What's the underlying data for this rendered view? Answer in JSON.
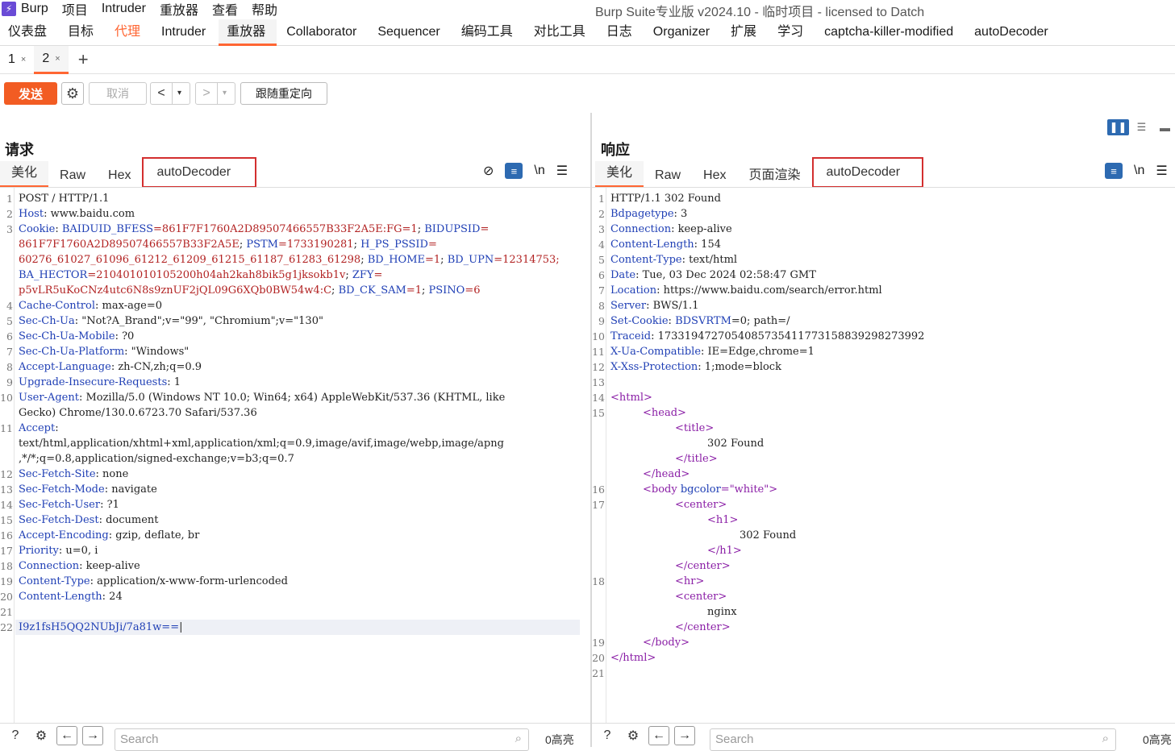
{
  "menubar": {
    "logo": "⚡",
    "items": [
      "Burp",
      "项目",
      "Intruder",
      "重放器",
      "查看",
      "帮助"
    ],
    "window_title": "Burp Suite专业版  v2024.10 - 临时项目 - licensed to Datch"
  },
  "top_tabs": [
    "仪表盘",
    "目标",
    "代理",
    "Intruder",
    "重放器",
    "Collaborator",
    "Sequencer",
    "编码工具",
    "对比工具",
    "日志",
    "Organizer",
    "扩展",
    "学习",
    "captcha-killer-modified",
    "autoDecoder"
  ],
  "active_top_tab": "重放器",
  "sub_tabs": [
    {
      "label": "1",
      "close": "×"
    },
    {
      "label": "2",
      "close": "×"
    }
  ],
  "add_tab": "+",
  "toolbar": {
    "send": "发送",
    "cancel": "取消",
    "back": "<",
    "forward": ">",
    "dropdown": "▾",
    "follow_redirect": "跟随重定向"
  },
  "request": {
    "title": "请求",
    "tabs": [
      "美化",
      "Raw",
      "Hex",
      "autoDecoder"
    ],
    "active_tab": "美化",
    "newline_toggle": "\\n",
    "search_placeholder": "Search",
    "hits": "0高亮"
  },
  "response": {
    "title": "响应",
    "tabs": [
      "美化",
      "Raw",
      "Hex",
      "页面渲染",
      "autoDecoder"
    ],
    "active_tab": "美化",
    "newline_toggle": "\\n",
    "search_placeholder": "Search",
    "hits": "0高亮"
  },
  "request_lines": [
    {
      "n": "1",
      "t": "POST / HTTP/1.1"
    },
    {
      "n": "2",
      "k": "Host",
      "v": " www.baidu.com"
    },
    {
      "n": "3",
      "cookie1": true
    },
    {
      "n": "",
      "cv": "861F7F1760A2D89507466557B33F2A5E",
      "rest": "; ",
      "k2": "PSTM",
      "v2": "=1733190281",
      "rest2": "; ",
      "k3": "H_PS_PSSID",
      "rest3": "="
    },
    {
      "n": "",
      "cv": "60276_61027_61096_61212_61209_61215_61187_61283_61298",
      "rest": "; ",
      "k2": "BD_HOME",
      "v2": "=1",
      "rest2": "; ",
      "k3": "BD_UPN",
      "rest3": "=12314753;"
    },
    {
      "n": "",
      "k0": "BA_HECTOR",
      "cv": "=210401010105200h04ah2kah8bik5g1jksokb1v",
      "rest": "; ",
      "k2": "ZFY",
      "v2": "=",
      "rest2": "",
      "k3": "",
      "rest3": ""
    },
    {
      "n": "",
      "cv": "p5vLR5uKoCNz4utc6N8s9znUF2jQL09G6XQb0BW54w4:C",
      "rest": "; ",
      "k2": "BD_CK_SAM",
      "v2": "=1",
      "rest2": "; ",
      "k3": "PSINO",
      "rest3": "=6"
    },
    {
      "n": "4",
      "k": "Cache-Control",
      "v": " max-age=0"
    },
    {
      "n": "5",
      "k": "Sec-Ch-Ua",
      "v": " \"Not?A_Brand\";v=\"99\", \"Chromium\";v=\"130\""
    },
    {
      "n": "6",
      "k": "Sec-Ch-Ua-Mobile",
      "v": " ?0"
    },
    {
      "n": "7",
      "k": "Sec-Ch-Ua-Platform",
      "v": " \"Windows\""
    },
    {
      "n": "8",
      "k": "Accept-Language",
      "v": " zh-CN,zh;q=0.9"
    },
    {
      "n": "9",
      "k": "Upgrade-Insecure-Requests",
      "v": " 1"
    },
    {
      "n": "10",
      "k": "User-Agent",
      "v": " Mozilla/5.0 (Windows NT 10.0; Win64; x64) AppleWebKit/537.36 (KHTML, like"
    },
    {
      "n": "",
      "t": "Gecko) Chrome/130.0.6723.70 Safari/537.36"
    },
    {
      "n": "11",
      "k": "Accept",
      "v": ""
    },
    {
      "n": "",
      "t": "text/html,application/xhtml+xml,application/xml;q=0.9,image/avif,image/webp,image/apng"
    },
    {
      "n": "",
      "t": ",*/*;q=0.8,application/signed-exchange;v=b3;q=0.7"
    },
    {
      "n": "12",
      "k": "Sec-Fetch-Site",
      "v": " none"
    },
    {
      "n": "13",
      "k": "Sec-Fetch-Mode",
      "v": " navigate"
    },
    {
      "n": "14",
      "k": "Sec-Fetch-User",
      "v": " ?1"
    },
    {
      "n": "15",
      "k": "Sec-Fetch-Dest",
      "v": " document"
    },
    {
      "n": "16",
      "k": "Accept-Encoding",
      "v": " gzip, deflate, br"
    },
    {
      "n": "17",
      "k": "Priority",
      "v": " u=0, i"
    },
    {
      "n": "18",
      "k": "Connection",
      "v": " keep-alive"
    },
    {
      "n": "19",
      "k": "Content-Type",
      "v": " application/x-www-form-urlencoded"
    },
    {
      "n": "20",
      "k": "Content-Length",
      "v": " 24"
    },
    {
      "n": "21",
      "t": ""
    },
    {
      "n": "22",
      "body": "I9z1fsH5QQ2NUbJi/7a81w=="
    }
  ],
  "cookie_line": {
    "k": "Cookie",
    "k1": "BAIDUID_BFESS",
    "v1": "=861F7F1760A2D89507466557B33F2A5E:FG=1",
    "k2": "BIDUPSID",
    "v2": "="
  },
  "response_lines": [
    {
      "n": "1",
      "t": "HTTP/1.1 302 Found"
    },
    {
      "n": "2",
      "k": "Bdpagetype",
      "v": " 3"
    },
    {
      "n": "3",
      "k": "Connection",
      "v": " keep-alive"
    },
    {
      "n": "4",
      "k": "Content-Length",
      "v": " 154"
    },
    {
      "n": "5",
      "k": "Content-Type",
      "v": " text/html"
    },
    {
      "n": "6",
      "k": "Date",
      "v": " Tue, 03 Dec 2024 02:58:47 GMT"
    },
    {
      "n": "7",
      "k": "Location",
      "v": " https://www.baidu.com/search/error.html"
    },
    {
      "n": "8",
      "k": "Server",
      "v": " BWS/1.1"
    },
    {
      "n": "9",
      "k": "Set-Cookie",
      "ck": "BDSVRTM",
      "v": "=0; path=/"
    },
    {
      "n": "10",
      "k": "Traceid",
      "v": " 1733194727054085735411773158839298273992"
    },
    {
      "n": "11",
      "k": "X-Ua-Compatible",
      "v": " IE=Edge,chrome=1"
    },
    {
      "n": "12",
      "k": "X-Xss-Protection",
      "v": " 1;mode=block"
    },
    {
      "n": "13",
      "t": ""
    },
    {
      "n": "14",
      "tag": "<html>",
      "ind": 0
    },
    {
      "n": "15",
      "tag": "<head>",
      "ind": 1
    },
    {
      "n": "",
      "tag": "<title>",
      "ind": 2
    },
    {
      "n": "",
      "t": "302 Found",
      "ind": 3
    },
    {
      "n": "",
      "tag": "</title>",
      "ind": 2
    },
    {
      "n": "",
      "tag": "</head>",
      "ind": 1
    },
    {
      "n": "16",
      "tag": "<body ",
      "attr": "bgcolor",
      "str": "=\"white\"",
      "close": ">",
      "ind": 1
    },
    {
      "n": "17",
      "tag": "<center>",
      "ind": 2
    },
    {
      "n": "",
      "tag": "<h1>",
      "ind": 3
    },
    {
      "n": "",
      "t": "302 Found",
      "ind": 4
    },
    {
      "n": "",
      "tag": "</h1>",
      "ind": 3
    },
    {
      "n": "",
      "tag": "</center>",
      "ind": 2
    },
    {
      "n": "18",
      "tag": "<hr>",
      "ind": 2
    },
    {
      "n": "",
      "tag": "<center>",
      "ind": 2
    },
    {
      "n": "",
      "t": "nginx",
      "ind": 3
    },
    {
      "n": "",
      "tag": "</center>",
      "ind": 2
    },
    {
      "n": "19",
      "tag": "</body>",
      "ind": 1
    },
    {
      "n": "20",
      "tag": "</html>",
      "ind": 0
    },
    {
      "n": "21",
      "t": ""
    }
  ],
  "colors": {
    "accent": "#ff6633",
    "send": "#f25c23",
    "header_key": "#1f3fb5",
    "cookie_value": "#b22222",
    "html_tag": "#8a1ea6",
    "highlight_box": "#d32f2f"
  }
}
